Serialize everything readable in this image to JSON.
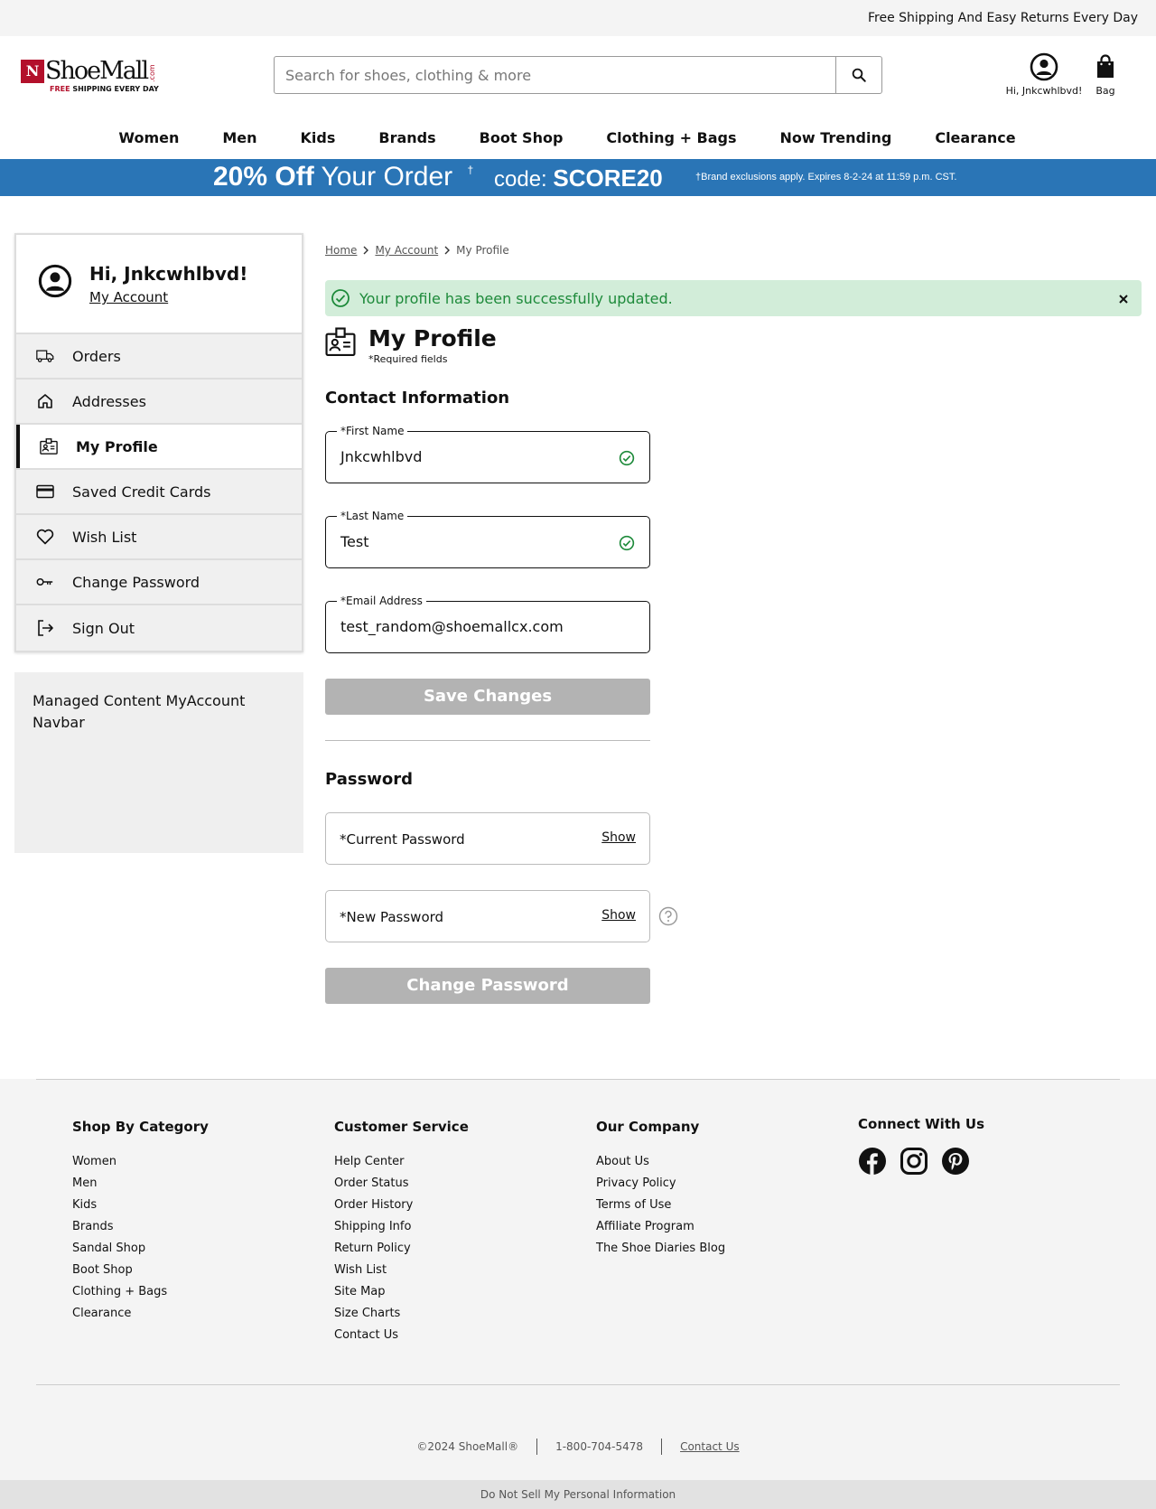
{
  "topbar": {
    "message": "Free Shipping And Easy Returns Every Day"
  },
  "logo": {
    "mark": "N",
    "text": "ShoeMall",
    "suffix": ".com",
    "tag_red": "FREE",
    "tag_rest": " SHIPPING EVERY DAY"
  },
  "search": {
    "placeholder": "Search for shoes, clothing & more"
  },
  "header": {
    "account_label": "Hi, Jnkcwhlbvd!",
    "bag_label": "Bag"
  },
  "nav": [
    "Women",
    "Men",
    "Kids",
    "Brands",
    "Boot Shop",
    "Clothing + Bags",
    "Now Trending",
    "Clearance"
  ],
  "promo": {
    "percent": "20% Off",
    "rest": " Your Order ",
    "dagger": "†",
    "code_label": "code: ",
    "code": "SCORE20",
    "fine": "†Brand exclusions apply. Expires 8-2-24 at 11:59 p.m. CST."
  },
  "sidebar": {
    "greeting": "Hi, Jnkcwhlbvd!",
    "account_link": "My Account",
    "items": [
      {
        "label": "Orders",
        "icon": "truck-icon"
      },
      {
        "label": "Addresses",
        "icon": "home-icon"
      },
      {
        "label": "My Profile",
        "icon": "id-card-icon"
      },
      {
        "label": "Saved Credit Cards",
        "icon": "credit-card-icon"
      },
      {
        "label": "Wish List",
        "icon": "heart-icon"
      },
      {
        "label": "Change Password",
        "icon": "key-icon"
      },
      {
        "label": "Sign Out",
        "icon": "sign-out-icon"
      }
    ],
    "managed_content": "Managed Content MyAccount Navbar"
  },
  "breadcrumb": {
    "home": "Home",
    "account": "My Account",
    "current": "My Profile"
  },
  "alert": {
    "message": "Your profile has been successfully updated."
  },
  "profile": {
    "title": "My Profile",
    "required_note": "*Required fields",
    "contact_title": "Contact Information",
    "first_name_label": "*First Name",
    "first_name_value": "Jnkcwhlbvd",
    "last_name_label": "*Last Name",
    "last_name_value": "Test",
    "email_label": "*Email Address",
    "email_value": "test_random@shoemallcx.com",
    "save_button": "Save Changes"
  },
  "password": {
    "title": "Password",
    "current_label": "*Current Password",
    "new_label": "*New Password",
    "show_label": "Show",
    "change_button": "Change Password"
  },
  "footer": {
    "columns": [
      {
        "title": "Shop By Category",
        "links": [
          "Women",
          "Men",
          "Kids",
          "Brands",
          "Sandal Shop",
          "Boot Shop",
          "Clothing + Bags",
          "Clearance"
        ]
      },
      {
        "title": "Customer Service",
        "links": [
          "Help Center",
          "Order Status",
          "Order History",
          "Shipping Info",
          "Return Policy",
          "Wish List",
          "Site Map",
          "Size Charts",
          "Contact Us"
        ]
      },
      {
        "title": "Our Company",
        "links": [
          "About Us",
          "Privacy Policy",
          "Terms of Use",
          "Affiliate Program",
          "The Shoe Diaries Blog"
        ]
      }
    ],
    "connect_title": "Connect With Us",
    "social": [
      "facebook-icon",
      "instagram-icon",
      "pinterest-icon"
    ],
    "copyright": "©2024 ShoeMall®",
    "phone": "1-800-704-5478",
    "contact_link": "Contact Us",
    "do_not_sell": "Do Not Sell My Personal Information"
  }
}
